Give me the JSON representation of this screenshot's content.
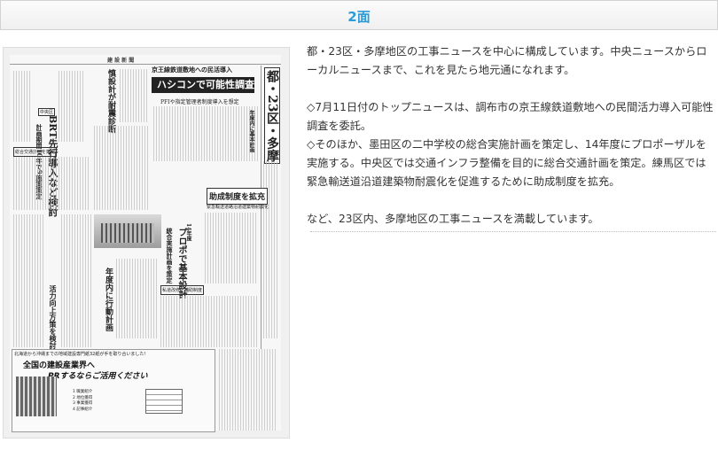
{
  "header": {
    "title": "2面"
  },
  "newspaper": {
    "masthead": "建 設 新 聞",
    "headlines": {
      "section_label": "都・23区・多摩",
      "banner": "ハシコンで可能性調査",
      "kicker": "京王線鉄道敷地への民活導入",
      "sub": "PFIや指定管理者制度導入を想定",
      "left_col_label": "中央区",
      "left_main": "BRT先行導入など検討",
      "left_sub": "計画期間10年で9施策策定",
      "box_label": "総合交通計画を策定",
      "seismic": "慎設計が耐震診断",
      "pro_main": "プロポで基本設計",
      "pro_sub": "統合実施計画を策定",
      "pro_year": "14年度",
      "subsidy": "助成制度を拡充",
      "subsidy_sub": "緊急輸送道路沿道建築物耐震化",
      "action": "年度内に行動計画",
      "lower_left": "活力向上方策を検討",
      "small_box": "私道改修に補助制度"
    },
    "ad": {
      "top_line": "北海道から沖縄までの地域建設専門紙32紙が手を取り合いました!",
      "title": "全国の建設産業界へ",
      "subtitle": "PRするならご活用ください",
      "items": [
        "1 職業紹介",
        "2 地位獲得",
        "3 事業獲得",
        "4 記事紹介"
      ]
    }
  },
  "description": {
    "intro": "都・23区・多摩地区の工事ニュースを中心に構成しています。中央ニュースからローカルニュースまで、これを見たら地元通になれます。",
    "points": "◇7月11日付のトップニュースは、調布市の京王線鉄道敷地への民間活力導入可能性調査を委託。\n◇そのほか、墨田区の二中学校の総合実施計画を策定し、14年度にプロポーザルを実施する。中央区では交通インフラ整備を目的に総合交通計画を策定。練馬区では緊急輸送道沿道建築物耐震化を促進するために助成制度を拡充。",
    "closing": "など、23区内、多摩地区の工事ニュースを満載しています。"
  }
}
